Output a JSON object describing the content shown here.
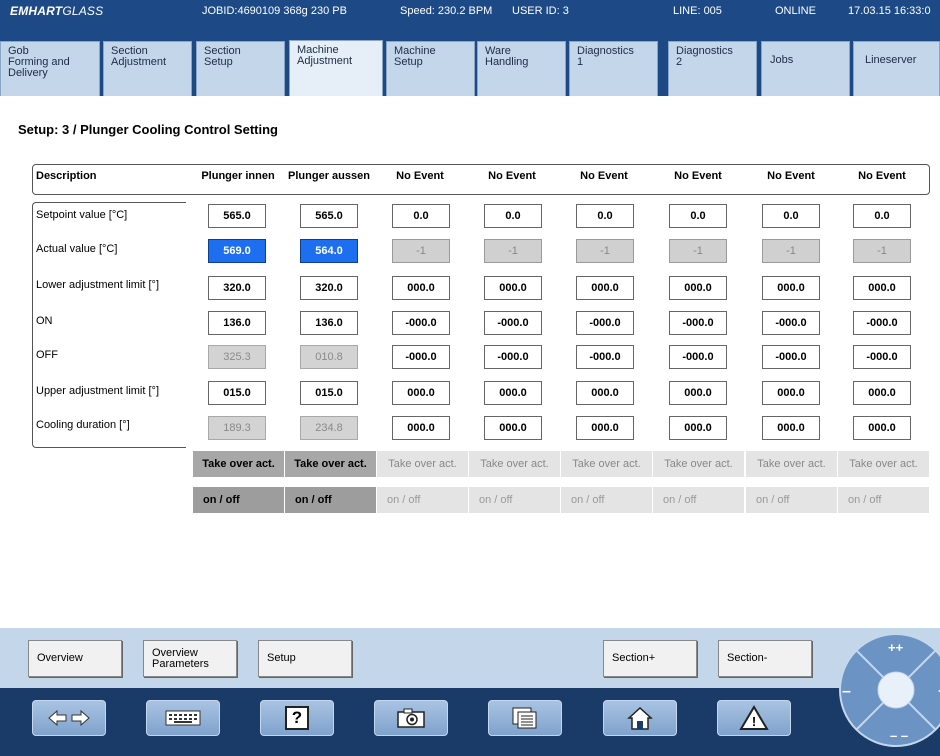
{
  "status": {
    "logo_bold": "EMHART",
    "logo_rest": "GLASS",
    "jobid": "JOBID:4690109 368g 230 PB",
    "speed": "Speed: 230.2 BPM",
    "user": "USER ID: 3",
    "line": "LINE: 005",
    "state": "ONLINE",
    "datetime": "17.03.15 16:33:0"
  },
  "tabs": [
    {
      "label": "Gob\nForming and\nDelivery"
    },
    {
      "label": "Section\nAdjustment"
    },
    {
      "label": "Section\nSetup"
    },
    {
      "label": "Machine\nAdjustment",
      "active": true
    },
    {
      "label": "Machine\nSetup"
    },
    {
      "label": "Ware\nHandling"
    },
    {
      "label": "Diagnostics\n1"
    },
    {
      "label": "Diagnostics\n2"
    },
    {
      "label": "Jobs"
    },
    {
      "label": "Lineserver"
    }
  ],
  "page": {
    "title": "Setup: 3 / Plunger Cooling Control Setting"
  },
  "table": {
    "description_header": "Description",
    "columns": [
      "Plunger innen",
      "Plunger aussen",
      "No Event",
      "No Event",
      "No Event",
      "No Event",
      "No Event",
      "No Event"
    ],
    "rows": [
      {
        "label": "Setpoint value [°C]",
        "values": [
          "565.0",
          "565.0",
          "0.0",
          "0.0",
          "0.0",
          "0.0",
          "0.0",
          "0.0"
        ]
      },
      {
        "label": "Actual value [°C]",
        "values": [
          "569.0",
          "564.0",
          "-1",
          "-1",
          "-1",
          "-1",
          "-1",
          "-1"
        ]
      },
      {
        "label": "Lower adjustment limit [°]",
        "values": [
          "320.0",
          "320.0",
          "000.0",
          "000.0",
          "000.0",
          "000.0",
          "000.0",
          "000.0"
        ]
      },
      {
        "label": "ON",
        "values": [
          "136.0",
          "136.0",
          "-000.0",
          "-000.0",
          "-000.0",
          "-000.0",
          "-000.0",
          "-000.0"
        ]
      },
      {
        "label": "OFF",
        "values": [
          "325.3",
          "010.8",
          "-000.0",
          "-000.0",
          "-000.0",
          "-000.0",
          "-000.0",
          "-000.0"
        ]
      },
      {
        "label": "Upper adjustment limit [°]",
        "values": [
          "015.0",
          "015.0",
          "000.0",
          "000.0",
          "000.0",
          "000.0",
          "000.0",
          "000.0"
        ]
      },
      {
        "label": "Cooling duration [°]",
        "values": [
          "189.3",
          "234.8",
          "000.0",
          "000.0",
          "000.0",
          "000.0",
          "000.0",
          "000.0"
        ]
      }
    ],
    "take_over_label": "Take over act.",
    "onoff_label": "on / off"
  },
  "nav_buttons": {
    "overview": "Overview",
    "overview_parameters": "Overview\nParameters",
    "setup": "Setup",
    "section_plus": "Section+",
    "section_minus": "Section-"
  },
  "toolbar": {
    "help_glyph": "?",
    "warning_glyph": "!"
  },
  "colors": {
    "header_blue": "#1d4a86",
    "tab_light": "#c4d6e9",
    "actual_value_blue": "#1e6ff0"
  }
}
